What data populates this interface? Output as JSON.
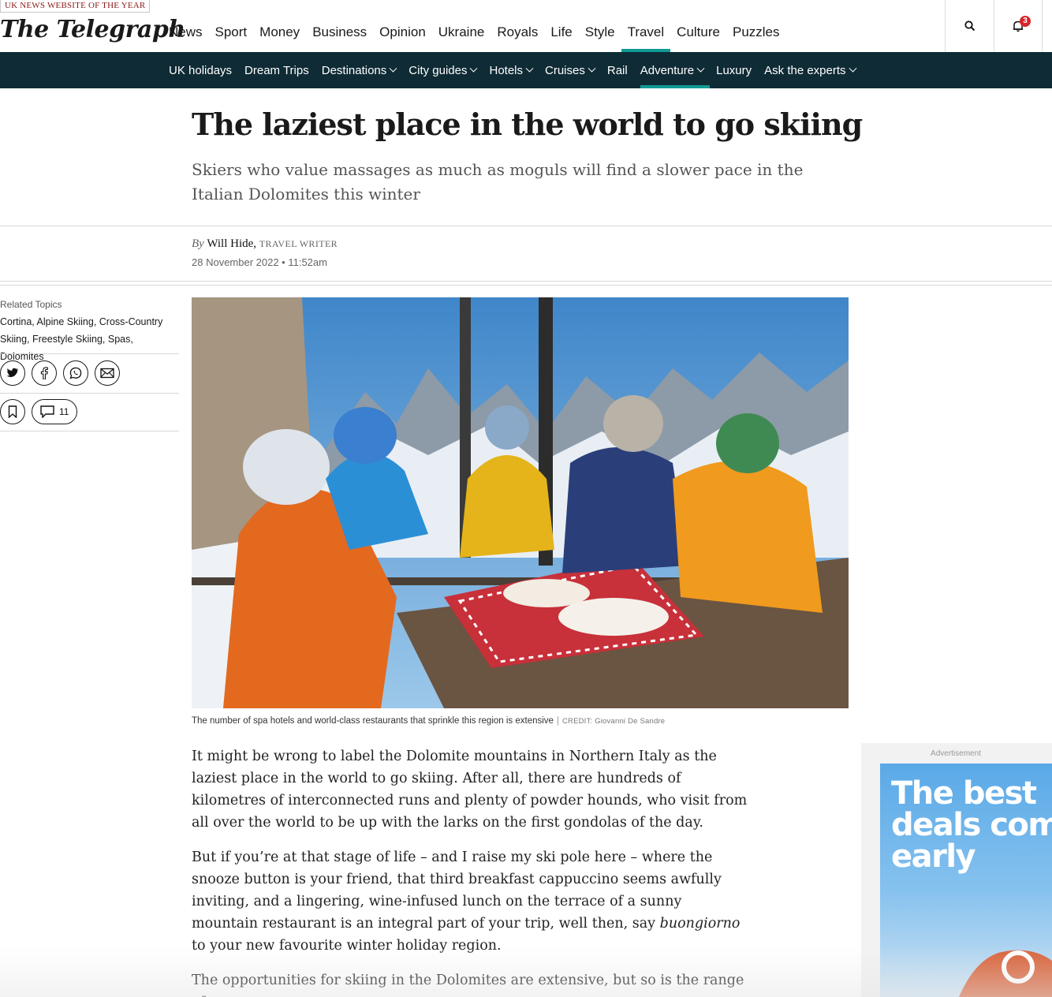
{
  "header": {
    "award": "UK NEWS WEBSITE OF THE YEAR",
    "logo": "The Telegraph",
    "nav": [
      "News",
      "Sport",
      "Money",
      "Business",
      "Opinion",
      "Ukraine",
      "Royals",
      "Life",
      "Style",
      "Travel",
      "Culture",
      "Puzzles"
    ],
    "active_nav": "Travel",
    "notification_count": "3"
  },
  "section_nav": {
    "items": [
      {
        "label": "UK holidays"
      },
      {
        "label": "Dream Trips"
      },
      {
        "label": "Destinations"
      },
      {
        "label": "City guides"
      },
      {
        "label": "Hotels"
      },
      {
        "label": "Cruises"
      },
      {
        "label": "Rail"
      },
      {
        "label": "Adventure"
      },
      {
        "label": "Luxury"
      },
      {
        "label": "Ask the experts"
      }
    ],
    "active": "Adventure"
  },
  "article": {
    "headline": "The laziest place in the world to go skiing",
    "standfirst": "Skiers who value massages as much as moguls will find a slower pace in the Italian Dolomites this winter",
    "byline_by": "By",
    "author": "Will Hide,",
    "role": "TRAVEL WRITER",
    "date": "28 November 2022 • 11:52am",
    "image_caption": "The number of spa hotels and world-class restaurants that sprinkle this region is extensive",
    "image_separator": "|",
    "image_credit": "CREDIT: Giovanni De Sandre",
    "paragraphs": [
      "It might be wrong to label the Dolomite mountains in Northern Italy as the laziest place in the world to go skiing. After all, there are hundreds of kilometres of interconnected runs and plenty of powder hounds, who visit from all over the world to be up with the larks on the first gondolas of the day.",
      "But if you’re at that stage of life – and I raise my ski pole here – where the snooze button is your friend, that third breakfast cappuccino seems awfully inviting, and a lingering, wine-infused lunch on the terrace of a sunny mountain restaurant is an integral part of your trip, well then, say",
      "buongiorno",
      "to your new favourite winter holiday region.",
      "The opportunities for skiing in the Dolomites are extensive, but so is the range of new"
    ]
  },
  "sidebar": {
    "related_label": "Related Topics",
    "related_topics": "Cortina, Alpine Skiing, Cross-Country Skiing, Freestyle Skiing, Spas, Dolomites",
    "comment_count": "11",
    "share_icons": [
      "twitter-icon",
      "facebook-icon",
      "whatsapp-icon",
      "email-icon"
    ]
  },
  "ad": {
    "label": "Advertisement",
    "headline": "The best deals come early"
  },
  "colors": {
    "accent": "#0f9a95",
    "section_nav_bg": "#0f2b35",
    "badge": "#d6262a"
  }
}
